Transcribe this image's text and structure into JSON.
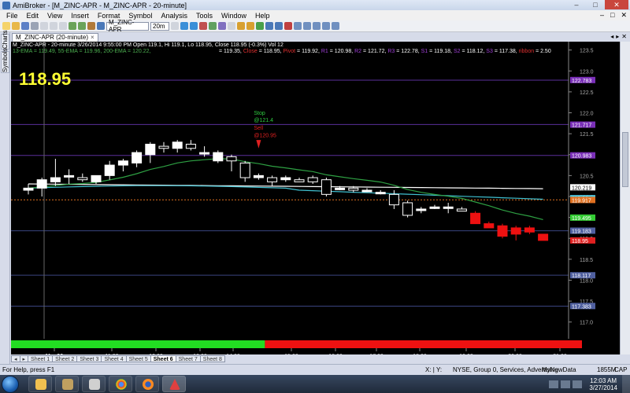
{
  "window": {
    "title": "AmiBroker - [M_ZINC-APR - M_ZINC-APR - 20-minute]",
    "minimize": "–",
    "maximize": "□",
    "close": "✕"
  },
  "menu": [
    "File",
    "Edit",
    "View",
    "Insert",
    "Format",
    "Symbol",
    "Analysis",
    "Tools",
    "Window",
    "Help"
  ],
  "toolbar": {
    "symbol": "M_ZINC-APR",
    "interval": "20m"
  },
  "side_tabs": [
    "Charts",
    "Symbols"
  ],
  "chart_tab": {
    "label": "M_ZINC-APR (20-minute)",
    "close": "×"
  },
  "chart_info": {
    "line1": "M_ZINC-APR - 20-minute 3/26/2014 9:55:00 PM Open 119.1, Hi 119.1, Lo 118.95, Close 118.95 (-0.3%) Vol 12",
    "ema_text": "13-EMA = 119.49, 55-EMA = 119.96, 200-EMA = 120.22,",
    "pivot_prefix": "= 119.35,",
    "close_label": "Close",
    "close_value": "= 118.95,",
    "pivot_label": "Pivot",
    "pivot_value": "= 119.92,",
    "r1_label": "R1",
    "r1_value": "= 120.98,",
    "r2_label": "R2",
    "r2_value": "= 121.72,",
    "r3_label": "R3",
    "r3_value": "= 122.78,",
    "s1_label": "S1",
    "s1_value": "= 119.18,",
    "s2_label": "S2",
    "s2_value": "= 118.12,",
    "s3_label": "S3",
    "s3_value": "= 117.38,",
    "ribbon_label": "ribbon",
    "ribbon_value": "= 2.50"
  },
  "big_price": "118.95",
  "annotations": {
    "stop_label": "Stop",
    "stop_value": "@121.4",
    "sell_label": "Sell",
    "sell_value": "@120.95"
  },
  "chart_data": {
    "type": "candlestick",
    "y_axis": {
      "min": 116.6,
      "max": 123.7,
      "ticks": [
        117.0,
        117.5,
        118.0,
        118.5,
        119.0,
        119.5,
        120.0,
        120.5,
        121.0,
        121.5,
        122.0,
        122.5,
        123.0,
        123.5
      ]
    },
    "x_ticks": [
      "Mar 26",
      "11:00",
      "12:00",
      "13:00",
      "14:00",
      "15:00",
      "16:00",
      "17:00",
      "18:00",
      "19:00",
      "20:00",
      "21:00"
    ],
    "candles": [
      {
        "o": 120.15,
        "h": 120.3,
        "l": 120.05,
        "c": 120.2
      },
      {
        "o": 120.2,
        "h": 120.45,
        "l": 120.0,
        "c": 120.4
      },
      {
        "o": 120.35,
        "h": 120.9,
        "l": 120.25,
        "c": 120.45
      },
      {
        "o": 120.5,
        "h": 120.65,
        "l": 120.3,
        "c": 120.5
      },
      {
        "o": 120.45,
        "h": 120.55,
        "l": 120.35,
        "c": 120.4
      },
      {
        "o": 120.35,
        "h": 120.5,
        "l": 120.3,
        "c": 120.5
      },
      {
        "o": 120.5,
        "h": 120.85,
        "l": 120.4,
        "c": 120.75
      },
      {
        "o": 120.75,
        "h": 120.9,
        "l": 120.6,
        "c": 120.85
      },
      {
        "o": 120.8,
        "h": 121.1,
        "l": 120.7,
        "c": 121.05
      },
      {
        "o": 121.0,
        "h": 121.3,
        "l": 120.8,
        "c": 121.25
      },
      {
        "o": 121.2,
        "h": 121.3,
        "l": 121.05,
        "c": 121.15
      },
      {
        "o": 121.15,
        "h": 121.35,
        "l": 121.05,
        "c": 121.3
      },
      {
        "o": 121.25,
        "h": 121.35,
        "l": 121.1,
        "c": 121.15
      },
      {
        "o": 121.05,
        "h": 121.2,
        "l": 120.95,
        "c": 121.05
      },
      {
        "o": 120.85,
        "h": 121.1,
        "l": 120.8,
        "c": 121.05
      },
      {
        "o": 120.95,
        "h": 121.0,
        "l": 120.6,
        "c": 120.85
      },
      {
        "o": 120.8,
        "h": 120.85,
        "l": 120.35,
        "c": 120.45
      },
      {
        "o": 120.45,
        "h": 120.55,
        "l": 120.4,
        "c": 120.5
      },
      {
        "o": 120.45,
        "h": 120.5,
        "l": 120.25,
        "c": 120.35
      },
      {
        "o": 120.4,
        "h": 120.5,
        "l": 120.35,
        "c": 120.45
      },
      {
        "o": 120.4,
        "h": 120.45,
        "l": 120.35,
        "c": 120.35
      },
      {
        "o": 120.45,
        "h": 120.5,
        "l": 120.3,
        "c": 120.35
      },
      {
        "o": 120.4,
        "h": 120.45,
        "l": 120.0,
        "c": 120.05
      },
      {
        "o": 120.2,
        "h": 120.25,
        "l": 120.15,
        "c": 120.2
      },
      {
        "o": 120.2,
        "h": 120.25,
        "l": 120.1,
        "c": 120.15
      },
      {
        "o": 120.15,
        "h": 120.2,
        "l": 120.1,
        "c": 120.15
      },
      {
        "o": 120.1,
        "h": 120.15,
        "l": 120.05,
        "c": 120.1
      },
      {
        "o": 120.05,
        "h": 120.15,
        "l": 119.7,
        "c": 119.8
      },
      {
        "o": 119.85,
        "h": 119.9,
        "l": 119.5,
        "c": 119.55
      },
      {
        "o": 119.7,
        "h": 119.75,
        "l": 119.6,
        "c": 119.7
      },
      {
        "o": 119.75,
        "h": 119.8,
        "l": 119.7,
        "c": 119.75
      },
      {
        "o": 119.75,
        "h": 119.85,
        "l": 119.6,
        "c": 119.75
      },
      {
        "o": 119.7,
        "h": 119.75,
        "l": 119.65,
        "c": 119.65
      },
      {
        "o": 119.6,
        "h": 119.65,
        "l": 119.35,
        "c": 119.35
      },
      {
        "o": 119.35,
        "h": 119.4,
        "l": 119.25,
        "c": 119.25
      },
      {
        "o": 119.3,
        "h": 119.35,
        "l": 119.0,
        "c": 119.05
      },
      {
        "o": 119.25,
        "h": 119.3,
        "l": 118.95,
        "c": 119.1
      },
      {
        "o": 119.25,
        "h": 119.3,
        "l": 119.1,
        "c": 119.15
      },
      {
        "o": 119.1,
        "h": 119.1,
        "l": 118.95,
        "c": 118.95
      }
    ],
    "lines": {
      "pivot": 119.92,
      "r1": 120.98,
      "r2": 121.72,
      "r3": 122.78,
      "s1": 119.18,
      "s2": 118.12,
      "s3": 117.38
    },
    "right_labels": [
      {
        "value": "122.783",
        "color": "#7a2fb8"
      },
      {
        "value": "121.717",
        "color": "#7a2fb8"
      },
      {
        "value": "120.983",
        "color": "#7a2fb8"
      },
      {
        "value": "120.219",
        "color": "#ffffff"
      },
      {
        "value": "119.96",
        "color": "#4fc3d8"
      },
      {
        "value": "119.917",
        "color": "#e07020"
      },
      {
        "value": "119.495",
        "color": "#33cc33"
      },
      {
        "value": "119.183",
        "color": "#5060a0"
      },
      {
        "value": "118.95",
        "color": "#e02020"
      },
      {
        "value": "118.117",
        "color": "#5060a0"
      },
      {
        "value": "117.383",
        "color": "#5060a0"
      }
    ],
    "ribbon": {
      "green_until_index": 17,
      "green": "#22dd22",
      "red": "#ee1111"
    },
    "colors": {
      "up": "#ffffff",
      "down_before": "#ffffff",
      "down_after": "#ee1111",
      "ema13": "#2ea043",
      "ema55": "#40c0d0",
      "ema200": "#ffffff",
      "pivot": "#e07020",
      "grid": "#3a3a78"
    }
  },
  "sheets": [
    "Sheet 1",
    "Sheet 2",
    "Sheet 3",
    "Sheet 4",
    "Sheet 5",
    "Sheet 6",
    "Sheet 7",
    "Sheet 8"
  ],
  "active_sheet": "Sheet 6",
  "status": {
    "help": "For Help, press F1",
    "coords": "X:   | Y:",
    "exchange": "NYSE, Group 0, Services, Advertising",
    "db": "MyNewData",
    "mem": "1855M",
    "cap": "CAP"
  },
  "taskbar": {
    "time": "12:03 AM",
    "date": "3/27/2014"
  }
}
